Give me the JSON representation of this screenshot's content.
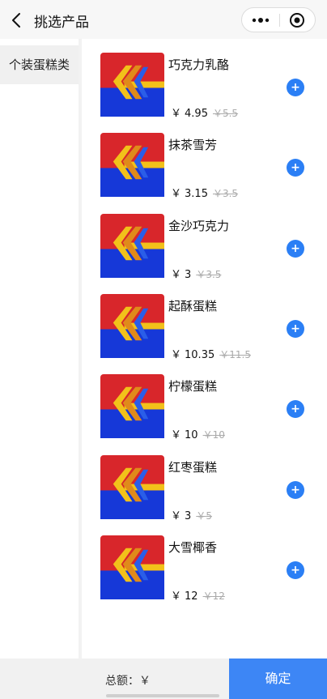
{
  "header": {
    "title": "挑选产品",
    "back_icon": "chevron-left-icon",
    "more_icon": "more-dots-icon",
    "close_icon": "target-close-icon"
  },
  "sidebar": {
    "categories": [
      {
        "label": "个装蛋糕类",
        "selected": true
      }
    ]
  },
  "products": [
    {
      "name": "巧克力乳酪",
      "currency": "￥",
      "price": "4.95",
      "original_price": "5.5",
      "add_label": "+"
    },
    {
      "name": "抹茶雪芳",
      "currency": "￥",
      "price": "3.15",
      "original_price": "3.5",
      "add_label": "+"
    },
    {
      "name": "金沙巧克力",
      "currency": "￥",
      "price": "3",
      "original_price": "3.5",
      "add_label": "+"
    },
    {
      "name": "起酥蛋糕",
      "currency": "￥",
      "price": "10.35",
      "original_price": "11.5",
      "add_label": "+"
    },
    {
      "name": "柠檬蛋糕",
      "currency": "￥",
      "price": "10",
      "original_price": "10",
      "add_label": "+"
    },
    {
      "name": "红枣蛋糕",
      "currency": "￥",
      "price": "3",
      "original_price": "5",
      "add_label": "+"
    },
    {
      "name": "大雪椰香",
      "currency": "￥",
      "price": "12",
      "original_price": "12",
      "add_label": "+"
    }
  ],
  "footer": {
    "total_label": "总额：￥",
    "confirm_label": "确定"
  },
  "colors": {
    "accent": "#3d86f5",
    "add_button": "#2b7ff5",
    "logo_red": "#d8262b",
    "logo_blue": "#1638d8",
    "logo_yellow": "#f2c11a"
  }
}
